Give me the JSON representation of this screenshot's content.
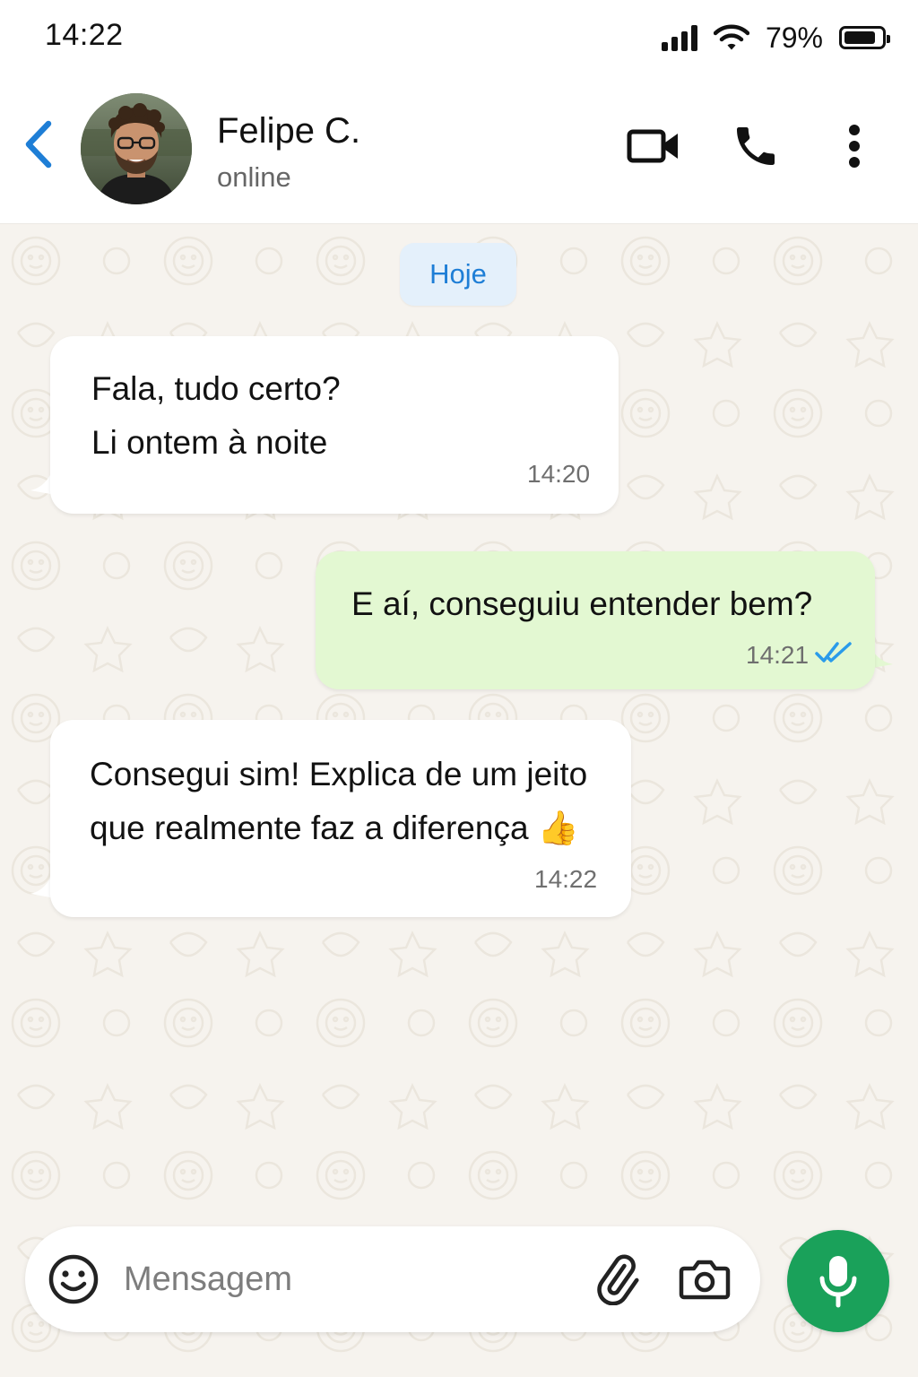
{
  "status_bar": {
    "time": "14:22",
    "battery_percent": "79%",
    "battery_level": 0.79,
    "icons": [
      "signal-icon",
      "wifi-icon",
      "battery-icon"
    ]
  },
  "header": {
    "contact_name": "Felipe C.",
    "contact_status": "online",
    "icons": [
      "back-arrow-icon",
      "video-call-icon",
      "voice-call-icon",
      "more-options-icon"
    ],
    "accent_color": "#1e7ed6"
  },
  "chat": {
    "date_chip": "Hoje",
    "messages": [
      {
        "direction": "incoming",
        "lines": [
          "Fala, tudo certo?",
          "Li ontem à noite"
        ],
        "time": "14:20"
      },
      {
        "direction": "outgoing",
        "lines": [
          "E aí, conseguiu entender bem?"
        ],
        "time": "14:21",
        "status": "read",
        "status_icon": "double-check-icon"
      },
      {
        "direction": "incoming",
        "lines": [
          "Consegui sim! Explica de um jeito",
          "que realmente faz a diferença 👍"
        ],
        "time": "14:22"
      }
    ],
    "colors": {
      "incoming_bubble": "#ffffff",
      "outgoing_bubble": "#e3f8d2",
      "read_check": "#2a9bea"
    }
  },
  "composer": {
    "placeholder": "Mensagem",
    "value": "",
    "icons": [
      "emoji-icon",
      "attach-icon",
      "camera-icon",
      "microphone-icon"
    ],
    "mic_color": "#1aa15a"
  }
}
